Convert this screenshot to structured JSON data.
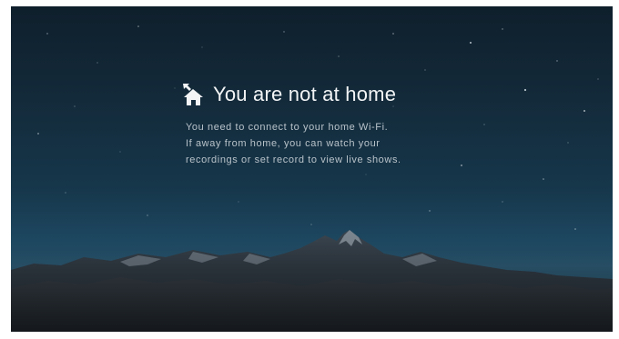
{
  "screen": {
    "title": "You are not at home",
    "icon": "home-icon",
    "description_lines": [
      "You need to connect to your home Wi-Fi.",
      "If away from home, you can watch your",
      "recordings or set record to view live shows."
    ]
  },
  "colors": {
    "sky_top": "#0f1f2c",
    "sky_horizon": "#264d63",
    "title_text": "#f2f4f5",
    "body_text": "#b9c3ca"
  }
}
